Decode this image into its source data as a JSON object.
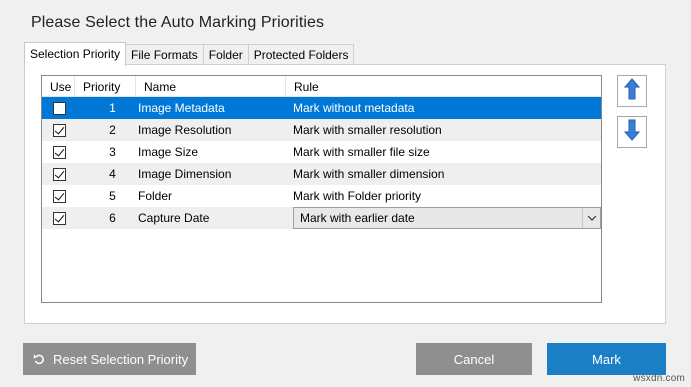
{
  "dialog": {
    "title": "Please Select the Auto Marking Priorities"
  },
  "tabs": [
    {
      "label": "Selection Priority",
      "active": true
    },
    {
      "label": "File Formats",
      "active": false
    },
    {
      "label": "Folder",
      "active": false
    },
    {
      "label": "Protected Folders",
      "active": false
    }
  ],
  "grid": {
    "columns": [
      "Use",
      "Priority",
      "Name",
      "Rule"
    ],
    "rows": [
      {
        "use": false,
        "priority": "1",
        "name": "Image Metadata",
        "rule": "Mark without metadata",
        "selected": true
      },
      {
        "use": true,
        "priority": "2",
        "name": "Image Resolution",
        "rule": "Mark with smaller resolution"
      },
      {
        "use": true,
        "priority": "3",
        "name": "Image Size",
        "rule": "Mark with smaller file size"
      },
      {
        "use": true,
        "priority": "4",
        "name": "Image Dimension",
        "rule": "Mark with smaller dimension"
      },
      {
        "use": true,
        "priority": "5",
        "name": "Folder",
        "rule": "Mark with Folder priority"
      },
      {
        "use": true,
        "priority": "6",
        "name": "Capture Date",
        "rule": "Mark with earlier date",
        "dropdown": true
      }
    ]
  },
  "side_buttons": {
    "up_icon": "arrow-up-icon",
    "down_icon": "arrow-down-icon"
  },
  "buttons": {
    "reset_label": "Reset Selection Priority",
    "reset_icon": "undo-icon",
    "cancel_label": "Cancel",
    "mark_label": "Mark"
  },
  "colors": {
    "selection": "#0078d7",
    "primary_button": "#1a7fc4",
    "secondary_button": "#8f8f8f",
    "arrow_blue": "#3b7ed6"
  },
  "watermark": "wsxdn.com"
}
